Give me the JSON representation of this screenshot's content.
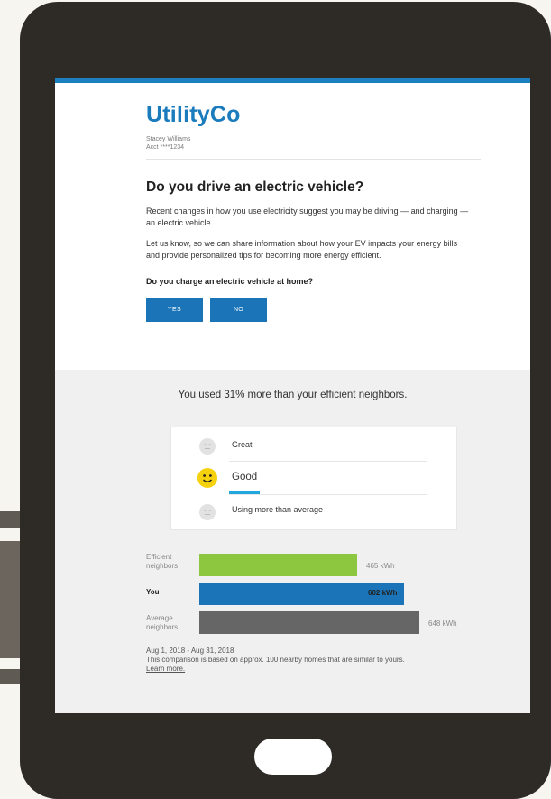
{
  "email": {
    "brand": "UtilityCo",
    "customer_name": "Stacey Williams",
    "account": "Acct ****1234",
    "headline": "Do you drive an electric vehicle?",
    "paragraph_1": "Recent changes in how you use electricity suggest you may be driving — and charging — an electric vehicle.",
    "paragraph_2": "Let us know, so we can share information about how your EV impacts your energy bills and provide personalized tips for becoming more energy efficient.",
    "question": "Do you charge an electric vehicle at home?",
    "yes_label": "YES",
    "no_label": "NO"
  },
  "comparison": {
    "headline": "You used 31% more than your efficient neighbors.",
    "ratings": [
      {
        "label": "Great",
        "active": false
      },
      {
        "label": "Good",
        "active": true
      },
      {
        "label": "Using more than average",
        "active": false
      }
    ],
    "bars": [
      {
        "label_line1": "Efficient",
        "label_line2": "neighbors",
        "value": "465 kWh",
        "kwh": 465,
        "color": "#8dc63f",
        "highlight": false
      },
      {
        "label_line1": "You",
        "label_line2": "",
        "value": "602 kWh",
        "kwh": 602,
        "color": "#1a74b7",
        "highlight": true
      },
      {
        "label_line1": "Average",
        "label_line2": "neighbors",
        "value": "648 kWh",
        "kwh": 648,
        "color": "#666666",
        "highlight": false
      }
    ],
    "period": "Aug 1, 2018 - Aug 31, 2018",
    "note": "This comparison is based on approx. 100 nearby homes that are similar to yours.",
    "learn_more": "Learn more."
  },
  "colors": {
    "brand_blue": "#1a7bbd",
    "tablet_frame": "#2e2b27",
    "good_face": "#f5d20d",
    "active_indicator": "#21a7de"
  },
  "icons": {
    "face_neutral": "neutral-face-icon",
    "face_smile": "smile-face-icon"
  }
}
